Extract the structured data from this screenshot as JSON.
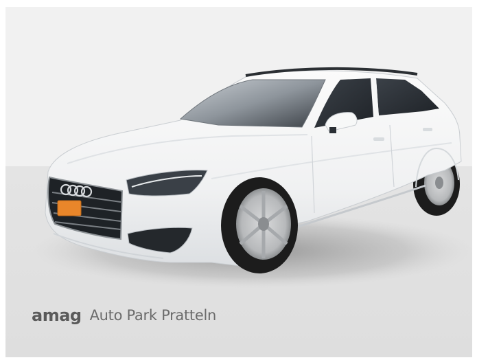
{
  "image": {
    "subject": "car-photo",
    "colors": {
      "backdrop_top": "#f1f1f1",
      "backdrop_floor": "#e3e3e3",
      "car_body": "#f5f6f6",
      "glass": "#2a2f35",
      "plate_orange": "#e9862a"
    }
  },
  "dealer": {
    "brand": "amag",
    "location": "Auto Park Pratteln"
  }
}
